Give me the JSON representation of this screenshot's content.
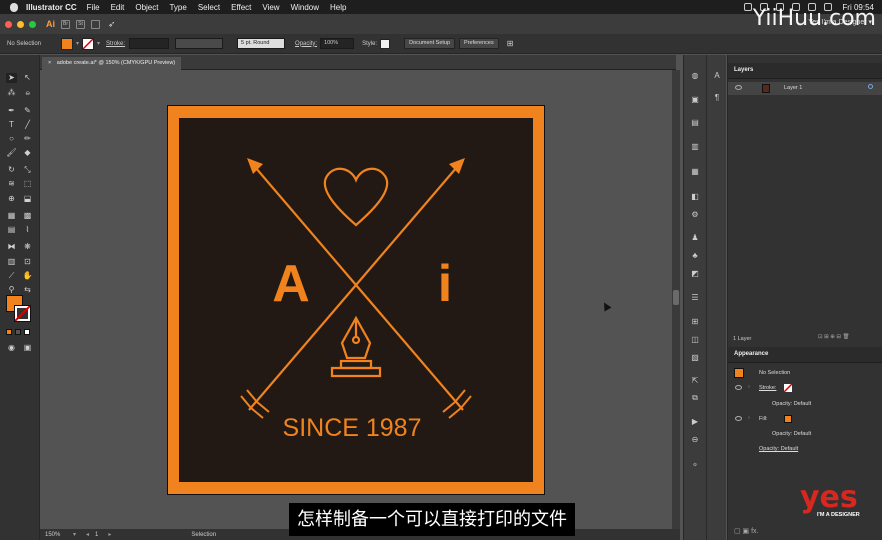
{
  "menubar": {
    "app_name": "Illustrator CC",
    "items": [
      "File",
      "Edit",
      "Object",
      "Type",
      "Select",
      "Effect",
      "View",
      "Window",
      "Help"
    ],
    "clock": "Fri 09:54"
  },
  "appbar": {
    "badge": "Ai",
    "btn_br": "Br",
    "btn_st": "St",
    "workspace": "Yes I'm a Designer ▾"
  },
  "control": {
    "selection_label": "No Selection",
    "stroke_label": "Stroke:",
    "brush_value": "5 pt. Round",
    "opacity_label": "Opacity:",
    "opacity_value": "100%",
    "style_label": "Style:",
    "document_setup": "Document Setup",
    "preferences": "Preferences",
    "fill_color": "#f0831e"
  },
  "document": {
    "tab_title": "adobe create.ai* @ 150% (CMYK/GPU Preview)",
    "close": "×"
  },
  "artwork": {
    "letter_left": "A",
    "letter_right": "i",
    "tagline": "SINCE 1987",
    "orange": "#f0831e",
    "dark": "#221914"
  },
  "status": {
    "zoom": "150%",
    "artboard_number": "1",
    "mode": "Selection"
  },
  "layers_panel": {
    "title": "Layers",
    "layer_name": "Layer 1",
    "layer_count": "1 Layer"
  },
  "appearance_panel": {
    "title": "Appearance",
    "selection": "No Selection",
    "stroke": "Stroke:",
    "opacity_default_1": "Opacity: Default",
    "fill": "Fill:",
    "opacity_default_2": "Opacity: Default",
    "opacity_default_3": "Opacity: Default",
    "fill_swatch": "#f0831e"
  },
  "overlay": {
    "subtitle": "怎样制备一个可以直接打印的文件",
    "watermark": "YiiHuu.com",
    "logo": "yes",
    "logo_sub": "I'M A DESIGNER",
    "logo_color": "#d8271f"
  }
}
